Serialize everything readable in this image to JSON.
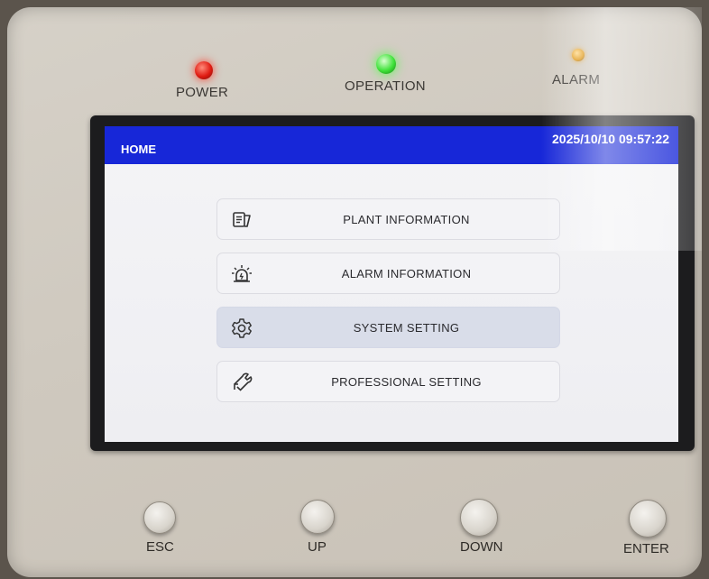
{
  "indicators": {
    "power_label": "POWER",
    "operation_label": "OPERATION",
    "alarm_label": "ALARM",
    "colors": {
      "power": "#e01b12",
      "operation": "#3fe23a",
      "alarm": "#e09a1a"
    }
  },
  "screen": {
    "title": "HOME",
    "datetime": "2025/10/10 09:57:22",
    "accent_color": "#1727d8",
    "menu": [
      {
        "label": "PLANT INFORMATION",
        "icon": "document-icon",
        "selected": false
      },
      {
        "label": "ALARM INFORMATION",
        "icon": "alarm-light-icon",
        "selected": false
      },
      {
        "label": "SYSTEM SETTING",
        "icon": "gear-icon",
        "selected": true
      },
      {
        "label": "PROFESSIONAL SETTING",
        "icon": "tools-icon",
        "selected": false
      }
    ]
  },
  "buttons": {
    "esc": "ESC",
    "up": "UP",
    "down": "DOWN",
    "enter": "ENTER"
  }
}
